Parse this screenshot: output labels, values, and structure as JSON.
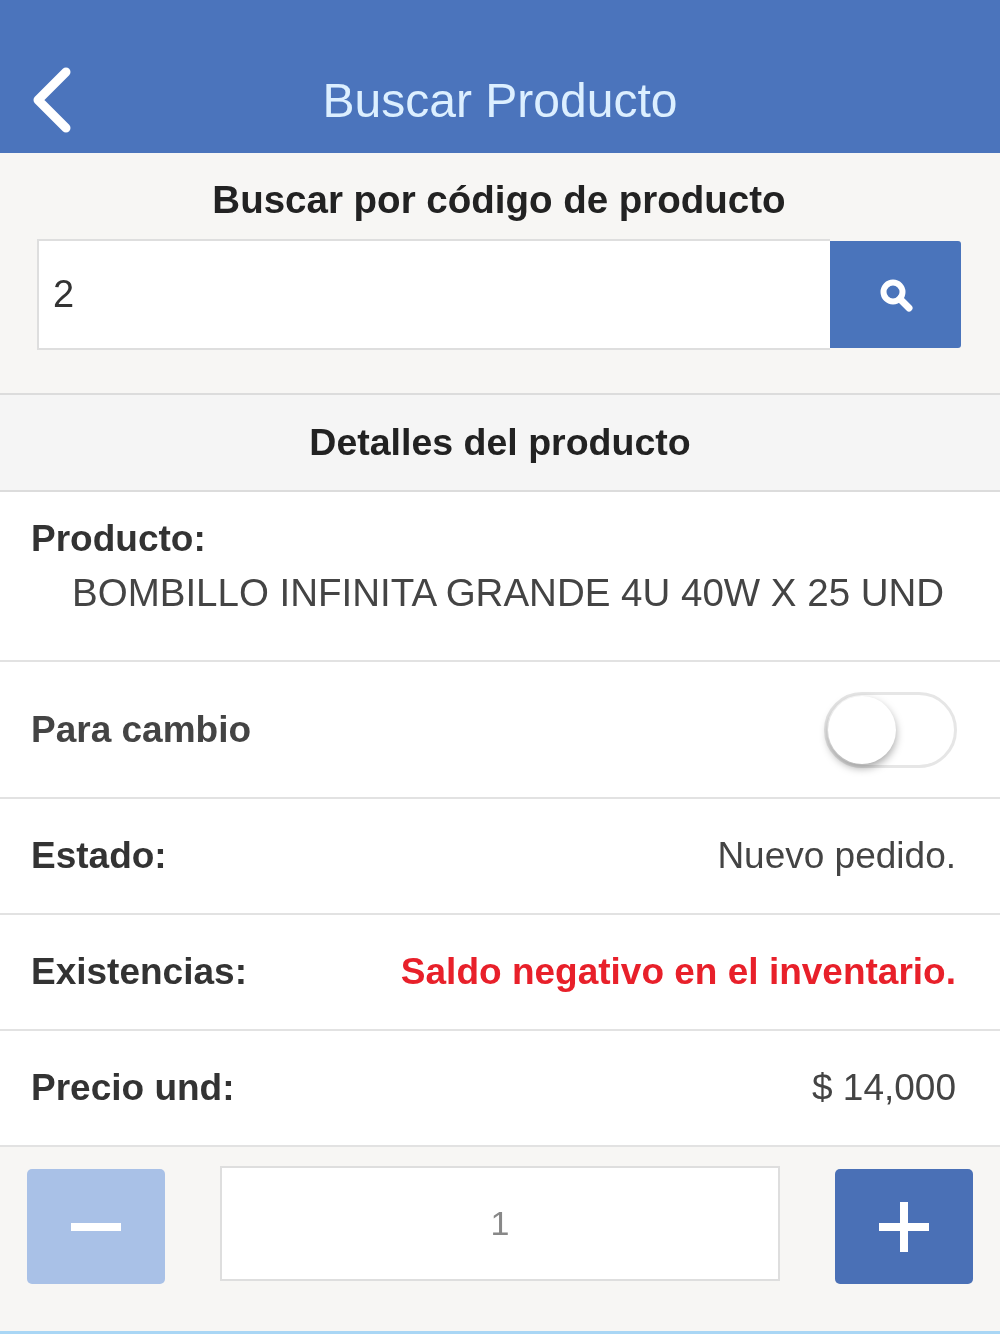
{
  "header": {
    "title": "Buscar Producto"
  },
  "search": {
    "label": "Buscar por código de producto",
    "value": "2"
  },
  "details": {
    "title": "Detalles del producto",
    "rows": [
      {
        "kind": "stacked",
        "label": "Producto:",
        "value": "BOMBILLO INFINITA GRANDE 4U 40W X 25 UND"
      },
      {
        "kind": "toggle",
        "label": "Para cambio",
        "on": false
      },
      {
        "kind": "pair",
        "label": "Estado:",
        "value": "Nuevo pedido."
      },
      {
        "kind": "alert",
        "label": "Existencias:",
        "value": "Saldo negativo en el inventario."
      },
      {
        "kind": "pair",
        "label": "Precio und:",
        "value": "$ 14,000"
      }
    ]
  },
  "quantity": {
    "value": "1",
    "decrement_disabled": true,
    "increment_disabled": false
  }
}
